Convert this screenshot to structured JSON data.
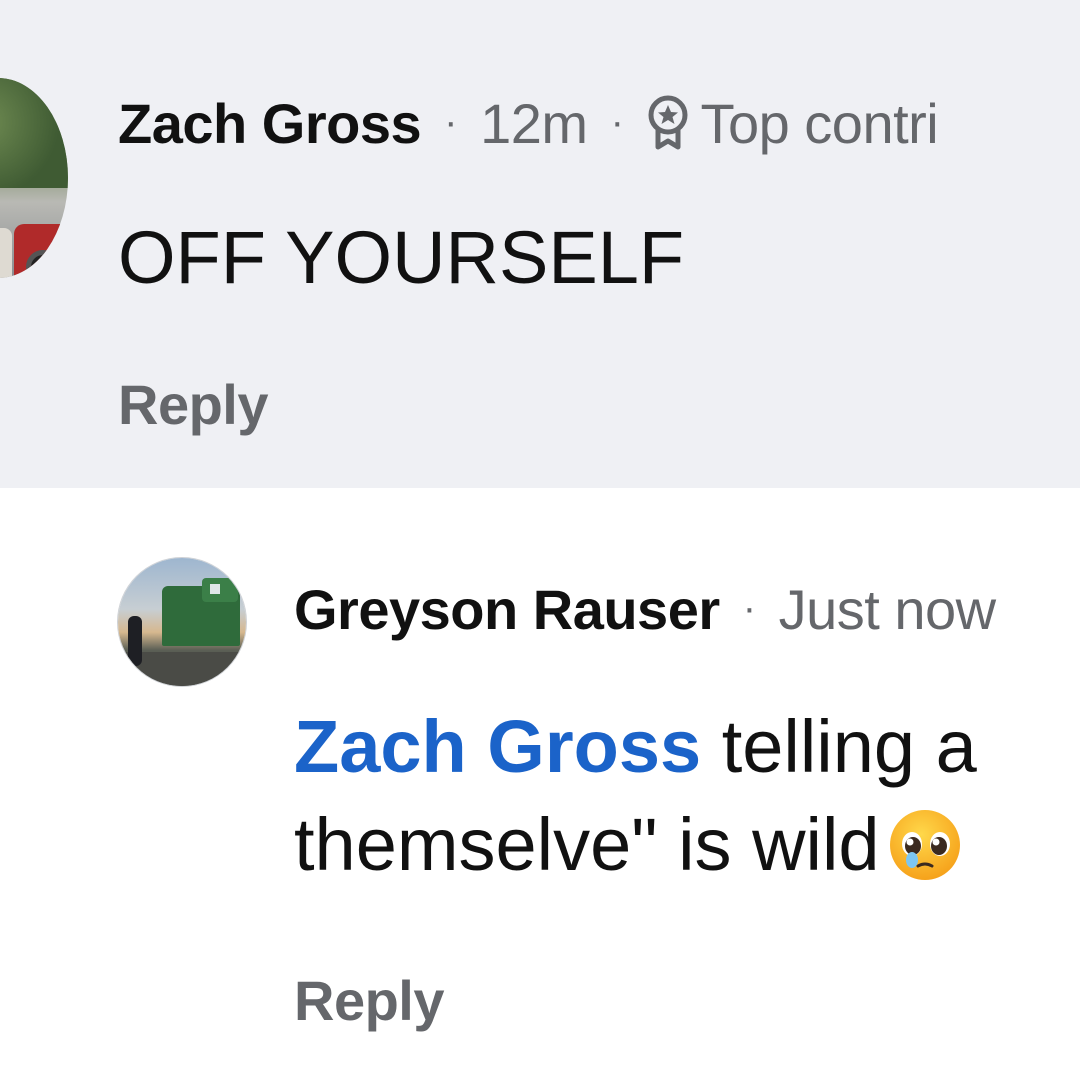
{
  "comments": [
    {
      "author": "Zach Gross",
      "time": "12m",
      "badge_label": "Top contri",
      "badge_icon": "top-contributor-badge-icon",
      "text": "OFF YOURSELF",
      "reply_label": "Reply",
      "highlighted": true,
      "background": "#eff0f4"
    },
    {
      "author": "Greyson Rauser",
      "time": "Just now",
      "mention": "Zach Gross",
      "text_line1_rest": " telling a",
      "text_line2": "themselve\" is wild",
      "emoji": "pleading-face-emoji-icon",
      "reply_label": "Reply",
      "highlighted": false,
      "background": "#ffffff"
    }
  ],
  "separator": "·",
  "colors": {
    "name": "#111111",
    "meta": "#65676b",
    "mention": "#1b63c9",
    "highlight_bg": "#eff0f4"
  }
}
